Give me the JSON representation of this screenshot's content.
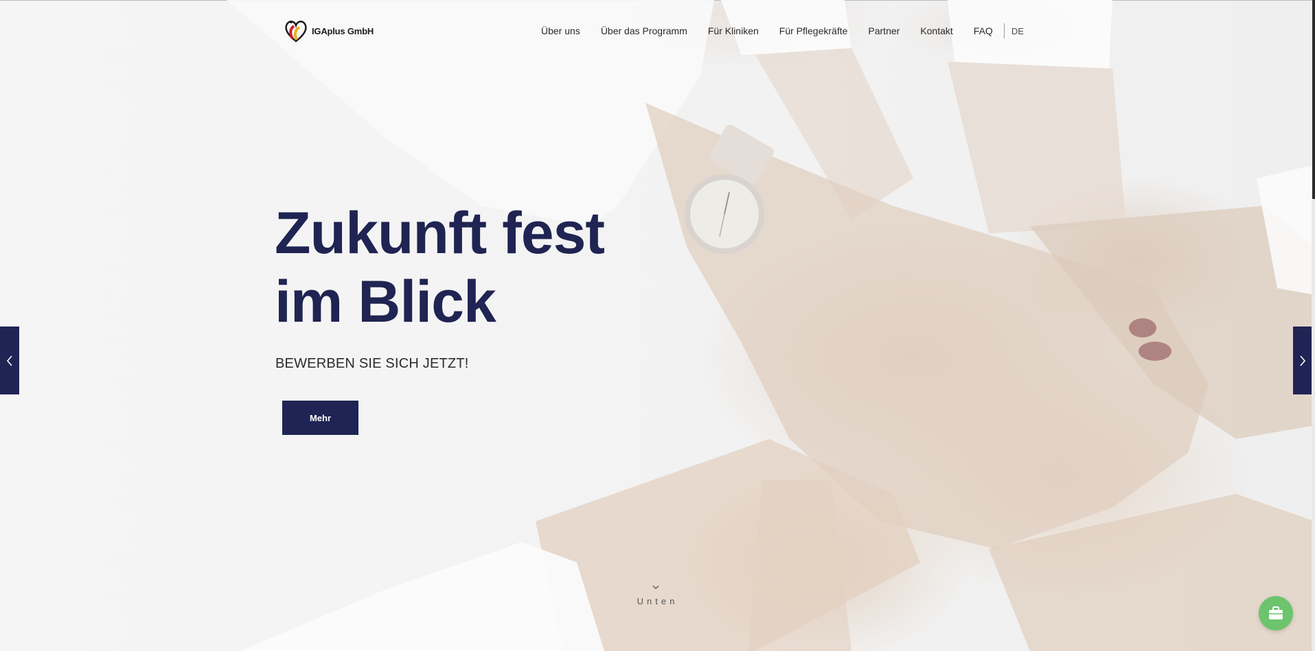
{
  "brand": {
    "name": "IGAplus GmbH",
    "tagline": "Zukunft fest im Blick"
  },
  "nav": {
    "items": [
      "Über uns",
      "Über das Programm",
      "Für Kliniken",
      "Für Pflegekräfte",
      "Partner",
      "Kontakt",
      "FAQ"
    ],
    "language": "DE"
  },
  "hero": {
    "headline_line1": "Zukunft fest",
    "headline_line2": "im Blick",
    "subline": "BEWERBEN SIE SICH JETZT!",
    "cta_label": "Mehr"
  },
  "scroll": {
    "label": "Unten"
  },
  "colors": {
    "accent_navy": "#1f2454",
    "chat_green": "#6cc46c"
  },
  "icons": {
    "prev": "chevron-left-icon",
    "next": "chevron-right-icon",
    "scroll": "chevron-down-icon",
    "chat": "briefcase-icon"
  }
}
